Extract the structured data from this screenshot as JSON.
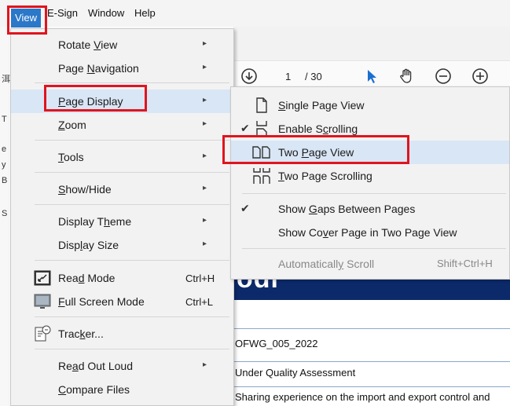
{
  "menubar": {
    "items": [
      "View",
      "E-Sign",
      "Window",
      "Help"
    ]
  },
  "colors": {
    "menu_bg": "#f2f2f2",
    "highlight": "#d9e6f5",
    "active_menu": "#2b78c8",
    "annotation": "#e0141e",
    "doc_banner": "#0c2a6a"
  },
  "toolbar": {
    "page_current": "1",
    "page_total": "/ 30"
  },
  "left_strip": [
    "洱",
    "T",
    "e",
    "y",
    "B",
    "S"
  ],
  "view_menu": {
    "items": [
      {
        "label_pre": "Rotate ",
        "label_u": "V",
        "label_post": "iew",
        "arrow": "▸",
        "icon": ""
      },
      {
        "label_pre": "Page ",
        "label_u": "N",
        "label_post": "avigation",
        "arrow": "▸",
        "icon": ""
      },
      {
        "label_pre": "",
        "label_u": "P",
        "label_post": "age Display",
        "arrow": "▸",
        "icon": ""
      },
      {
        "label_pre": "",
        "label_u": "Z",
        "label_post": "oom",
        "arrow": "▸",
        "icon": ""
      },
      {
        "label_pre": "",
        "label_u": "T",
        "label_post": "ools",
        "arrow": "▸",
        "icon": ""
      },
      {
        "label_pre": "",
        "label_u": "S",
        "label_post": "how/Hide",
        "arrow": "▸",
        "icon": ""
      },
      {
        "label_pre": "Display T",
        "label_u": "h",
        "label_post": "eme",
        "arrow": "▸",
        "icon": ""
      },
      {
        "label_pre": "Disp",
        "label_u": "l",
        "label_post": "ay Size",
        "arrow": "▸",
        "icon": ""
      },
      {
        "label_pre": "Rea",
        "label_u": "d",
        "label_post": " Mode",
        "shortcut": "Ctrl+H",
        "icon": "read-mode-icon"
      },
      {
        "label_pre": "",
        "label_u": "F",
        "label_post": "ull Screen Mode",
        "shortcut": "Ctrl+L",
        "icon": "full-screen-icon"
      },
      {
        "label_pre": "Trac",
        "label_u": "k",
        "label_post": "er...",
        "icon": "tracker-icon"
      },
      {
        "label_pre": "Re",
        "label_u": "a",
        "label_post": "d Out Loud",
        "arrow": "▸",
        "icon": ""
      },
      {
        "label_pre": "",
        "label_u": "C",
        "label_post": "ompare Files",
        "icon": ""
      }
    ]
  },
  "page_display_submenu": {
    "items": [
      {
        "label_pre": "",
        "label_u": "S",
        "label_post": "ingle Page View",
        "check": "",
        "icon": "single-page-icon"
      },
      {
        "label_pre": "Enable S",
        "label_u": "c",
        "label_post": "rolling",
        "check": "✔",
        "icon": "scrolling-icon"
      },
      {
        "label_pre": "Two ",
        "label_u": "P",
        "label_post": "age View",
        "check": "",
        "icon": "two-page-icon"
      },
      {
        "label_pre": "",
        "label_u": "T",
        "label_post": "wo Page Scrolling",
        "check": "",
        "icon": "two-page-scrolling-icon"
      },
      {
        "label_pre": "Show ",
        "label_u": "G",
        "label_post": "aps Between Pages",
        "check": "✔",
        "icon": ""
      },
      {
        "label_pre": "Show Co",
        "label_u": "v",
        "label_post": "er Page in Two Page View",
        "check": "",
        "icon": ""
      },
      {
        "label_pre": "Automaticall",
        "label_u": "y",
        "label_post": " Scroll",
        "check": "",
        "icon": "",
        "shortcut": "Shift+Ctrl+H",
        "disabled": true
      }
    ]
  },
  "document": {
    "banner_text": "odi",
    "row1": "OFWG_005_2022",
    "row2": "Under Quality Assessment",
    "row3": "Sharing experience on the import and export control and"
  }
}
